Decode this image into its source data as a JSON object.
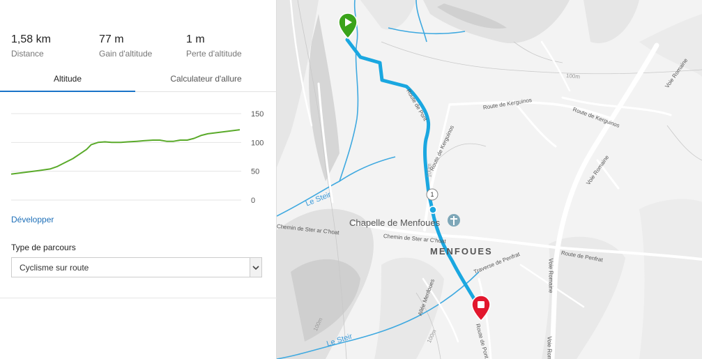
{
  "stats": [
    {
      "value": "1,58 km",
      "label": "Distance"
    },
    {
      "value": "77 m",
      "label": "Gain d'altitude"
    },
    {
      "value": "1 m",
      "label": "Perte d'altitude"
    }
  ],
  "tabs": [
    {
      "label": "Altitude",
      "active": true
    },
    {
      "label": "Calculateur d'allure",
      "active": false
    }
  ],
  "chart_data": {
    "type": "line",
    "title": "",
    "xlabel": "",
    "ylabel": "",
    "ylim": [
      0,
      150
    ],
    "yticks": [
      150,
      100,
      50,
      0
    ],
    "grid": true,
    "color": "#5aaa2a",
    "x": [
      0,
      0.06,
      0.12,
      0.17,
      0.2,
      0.23,
      0.27,
      0.3,
      0.33,
      0.35,
      0.38,
      0.41,
      0.44,
      0.48,
      0.51,
      0.55,
      0.58,
      0.62,
      0.65,
      0.68,
      0.71,
      0.74,
      0.77,
      0.8,
      0.83,
      0.86,
      0.9,
      0.94,
      1.0
    ],
    "series": [
      {
        "values": [
          45,
          48,
          51,
          54,
          58,
          64,
          72,
          80,
          88,
          96,
          100,
          101,
          100,
          100,
          101,
          102,
          103,
          104,
          104,
          102,
          102,
          104,
          104,
          107,
          112,
          115,
          117,
          119,
          122
        ]
      }
    ]
  },
  "develop_label": "Développer",
  "route_type": {
    "label": "Type de parcours",
    "selected": "Cyclisme sur route"
  },
  "map": {
    "poi": "Chapelle de Menfoues",
    "place": "MENFOUES",
    "km_marker": "1",
    "route_color": "#1aa7e0",
    "start_color": "#3aa31a",
    "end_color": "#e2172d",
    "roads": [
      {
        "text": "Route de Pont"
      },
      {
        "text": "Route de Kerguinos"
      },
      {
        "text": "Route de Kerguinos"
      },
      {
        "text": "Route de Kerguinos"
      },
      {
        "text": "Voie Romaine"
      },
      {
        "text": "Voie Romaine"
      },
      {
        "text": "Voie Romaine"
      },
      {
        "text": "Voie Romaine"
      },
      {
        "text": "Route de Penfrat"
      },
      {
        "text": "Traverse de Penfrat"
      },
      {
        "text": "Chemin de Ster ar C'hoat"
      },
      {
        "text": "Chemin de Ster ar C'hoat"
      },
      {
        "text": "Allée Menfoues"
      },
      {
        "text": "Route de Pont"
      }
    ],
    "water": [
      {
        "text": "Le Steir"
      },
      {
        "text": "Le Steir"
      }
    ],
    "contours": [
      {
        "text": "100m"
      },
      {
        "text": "100m"
      },
      {
        "text": "100m"
      },
      {
        "text": "100m"
      }
    ]
  }
}
